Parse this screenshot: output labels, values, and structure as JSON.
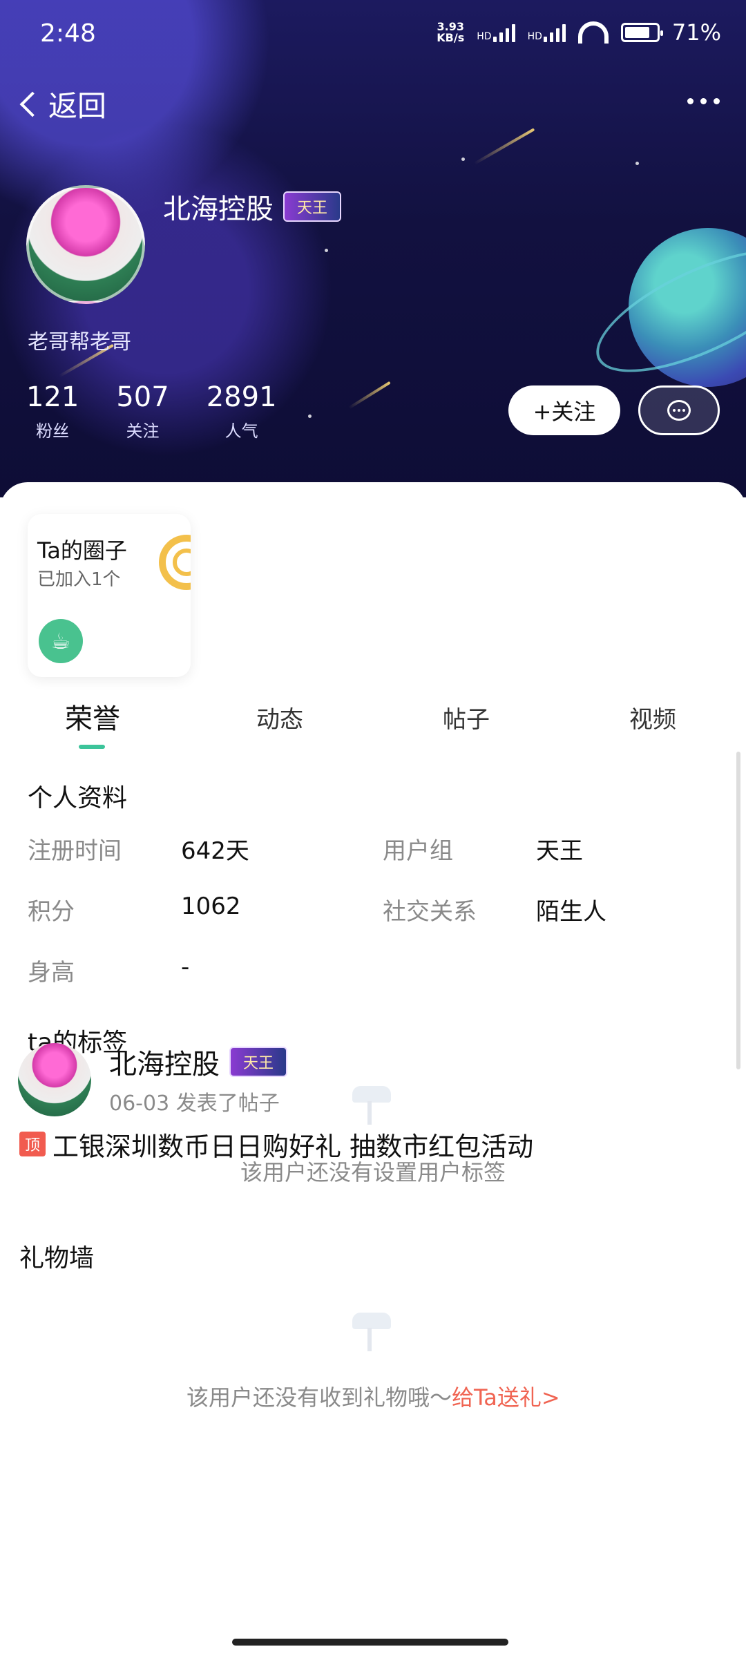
{
  "status_bar": {
    "time": "2:48",
    "net_speed_top": "3.93",
    "net_speed_bottom": "KB/s",
    "hd1": "HD",
    "hd2": "HD",
    "battery": "71%"
  },
  "header": {
    "back_label": "返回",
    "username": "北海控股",
    "badge": "天王",
    "bio": "老哥帮老哥",
    "stats": [
      {
        "value": "121",
        "label": "粉丝"
      },
      {
        "value": "507",
        "label": "关注"
      },
      {
        "value": "2891",
        "label": "人气"
      }
    ],
    "follow_label": "+关注"
  },
  "circle_card": {
    "title": "Ta的圈子",
    "subtitle": "已加入1个",
    "icon": "cup-icon"
  },
  "tabs": [
    {
      "label": "荣誉",
      "active": true
    },
    {
      "label": "动态",
      "active": false
    },
    {
      "label": "帖子",
      "active": false
    },
    {
      "label": "视频",
      "active": false
    }
  ],
  "profile": {
    "section_title": "个人资料",
    "rows": [
      {
        "label": "注册时间",
        "value": "642天"
      },
      {
        "label": "用户组",
        "value": "天王"
      },
      {
        "label": "积分",
        "value": "1062"
      },
      {
        "label": "社交关系",
        "value": "陌生人"
      },
      {
        "label": "身高",
        "value": "-"
      }
    ]
  },
  "tags": {
    "title": "ta的标签",
    "empty_text": "该用户还没有设置用户标签"
  },
  "gifts": {
    "title": "礼物墙",
    "empty_text": "该用户还没有收到礼物哦～",
    "link_text": "给Ta送礼>"
  },
  "post": {
    "username": "北海控股",
    "badge": "天王",
    "meta": "06-03 发表了帖子",
    "pin_label": "顶",
    "title": "工银深圳数币日日购好礼 抽数市红包活动"
  },
  "colors": {
    "accent": "#3cc49a",
    "link": "#f06452",
    "header_bg": "#121140"
  }
}
